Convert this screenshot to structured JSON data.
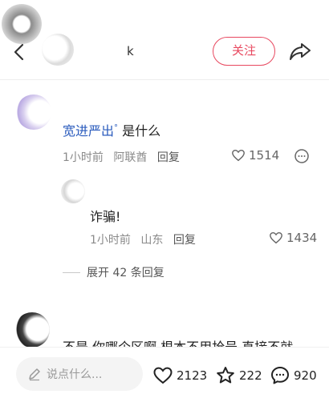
{
  "header": {
    "author_name": "k",
    "follow_label": "关注"
  },
  "comments": [
    {
      "author": "",
      "text_link": "宽进严出",
      "text_rest": "是什么",
      "time": "1小时前",
      "location": "阿联酋",
      "reply_label": "回复",
      "likes": "1514"
    },
    {
      "author": "",
      "text": "诈骗!",
      "time": "1小时前",
      "location": "山东",
      "reply_label": "回复",
      "likes": "1434"
    },
    {
      "author": "",
      "text": "不是 你哪个区啊 根本不用抢号 直接不就"
    }
  ],
  "expand_label": "展开 42 条回复",
  "bottom_bar": {
    "input_placeholder": "说点什么...",
    "like_count": "2123",
    "collect_count": "222",
    "comment_count": "920"
  },
  "colors": {
    "accent": "#e8485f",
    "link": "#2a5bbd"
  },
  "icons": [
    "back-arrow-icon",
    "share-icon",
    "heart-icon",
    "more-circle-icon",
    "pencil-icon",
    "star-icon",
    "comment-bubble-icon"
  ]
}
